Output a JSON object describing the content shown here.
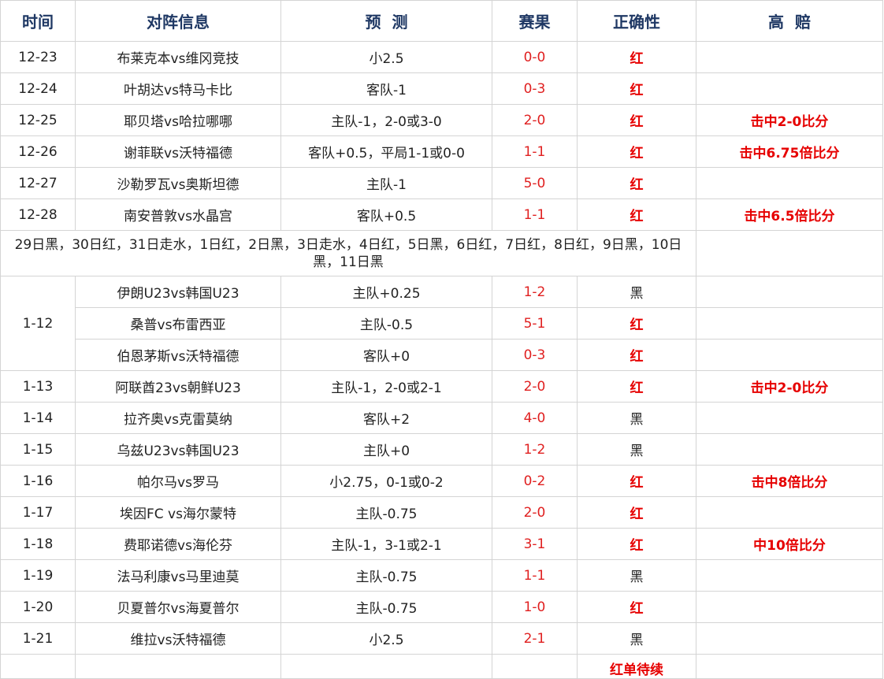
{
  "header": {
    "time": "时间",
    "match": "对阵信息",
    "prediction": "预  测",
    "score": "赛果",
    "correct": "正确性",
    "odds": "高  赔"
  },
  "rows_a": [
    {
      "time": "12-23",
      "match": "布莱克本vs维冈竞技",
      "prediction": "小2.5",
      "score": "0-0",
      "result": "红",
      "odds": ""
    },
    {
      "time": "12-24",
      "match": "叶胡达vs特马卡比",
      "prediction": "客队-1",
      "score": "0-3",
      "result": "红",
      "odds": ""
    },
    {
      "time": "12-25",
      "match": "耶贝塔vs哈拉哪哪",
      "prediction": "主队-1，2-0或3-0",
      "score": "2-0",
      "result": "红",
      "odds": "击中2-0比分"
    },
    {
      "time": "12-26",
      "match": "谢菲联vs沃特福德",
      "prediction": "客队+0.5，平局1-1或0-0",
      "score": "1-1",
      "result": "红",
      "odds": "击中6.75倍比分"
    },
    {
      "time": "12-27",
      "match": "沙勒罗瓦vs奥斯坦德",
      "prediction": "主队-1",
      "score": "5-0",
      "result": "红",
      "odds": ""
    },
    {
      "time": "12-28",
      "match": "南安普敦vs水晶宫",
      "prediction": "客队+0.5",
      "score": "1-1",
      "result": "红",
      "odds": "击中6.5倍比分"
    }
  ],
  "note": "29日黑，30日红，31日走水，1日红，2日黑，3日走水，4日红，5日黑，6日红，7日红，8日红，9日黑，10日黑，11日黑",
  "group_112": {
    "time": "1-12",
    "rows": [
      {
        "match": "伊朗U23vs韩国U23",
        "prediction": "主队+0.25",
        "score": "1-2",
        "result": "黑",
        "odds": ""
      },
      {
        "match": "桑普vs布雷西亚",
        "prediction": "主队-0.5",
        "score": "5-1",
        "result": "红",
        "odds": ""
      },
      {
        "match": "伯恩茅斯vs沃特福德",
        "prediction": "客队+0",
        "score": "0-3",
        "result": "红",
        "odds": ""
      }
    ]
  },
  "rows_b": [
    {
      "time": "1-13",
      "match": "阿联酋23vs朝鲜U23",
      "prediction": "主队-1，2-0或2-1",
      "score": "2-0",
      "result": "红",
      "odds": "击中2-0比分"
    },
    {
      "time": "1-14",
      "match": "拉齐奥vs克雷莫纳",
      "prediction": "客队+2",
      "score": "4-0",
      "result": "黑",
      "odds": ""
    },
    {
      "time": "1-15",
      "match": "乌兹U23vs韩国U23",
      "prediction": "主队+0",
      "score": "1-2",
      "result": "黑",
      "odds": ""
    },
    {
      "time": "1-16",
      "match": "帕尔马vs罗马",
      "prediction": "小2.75，0-1或0-2",
      "score": "0-2",
      "result": "红",
      "odds": "击中8倍比分"
    },
    {
      "time": "1-17",
      "match": "埃因FC vs海尔蒙特",
      "prediction": "主队-0.75",
      "score": "2-0",
      "result": "红",
      "odds": ""
    },
    {
      "time": "1-18",
      "match": "费耶诺德vs海伦芬",
      "prediction": "主队-1，3-1或2-1",
      "score": "3-1",
      "result": "红",
      "odds": "中10倍比分"
    },
    {
      "time": "1-19",
      "match": "法马利康vs马里迪莫",
      "prediction": "主队-0.75",
      "score": "1-1",
      "result": "黑",
      "odds": ""
    },
    {
      "time": "1-20",
      "match": "贝夏普尔vs海夏普尔",
      "prediction": "主队-0.75",
      "score": "1-0",
      "result": "红",
      "odds": ""
    },
    {
      "time": "1-21",
      "match": "维拉vs沃特福德",
      "prediction": "小2.5",
      "score": "2-1",
      "result": "黑",
      "odds": ""
    }
  ],
  "footer": {
    "status": "红单待续"
  },
  "colors": {
    "header_text": "#1f3864",
    "red": "#e60000",
    "score_red": "#e02020",
    "grid": "#d4d4d4"
  }
}
